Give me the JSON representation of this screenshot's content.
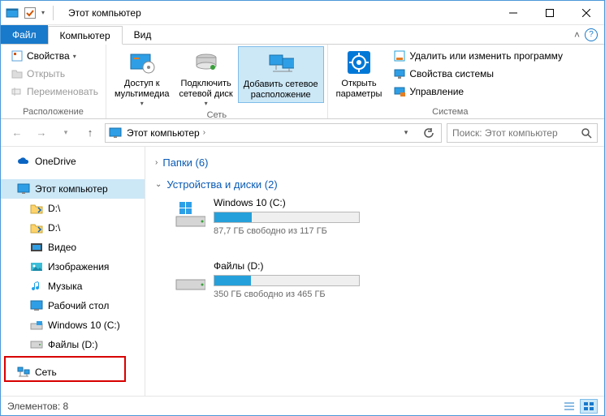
{
  "window": {
    "title": "Этот компьютер"
  },
  "tabs": {
    "file": "Файл",
    "computer": "Компьютер",
    "view": "Вид"
  },
  "ribbon": {
    "location": {
      "label": "Расположение",
      "properties": "Свойства",
      "open": "Открыть",
      "rename": "Переименовать"
    },
    "network": {
      "label": "Сеть",
      "media": "Доступ к\nмультимедиа",
      "mapdrive": "Подключить\nсетевой диск",
      "addloc": "Добавить сетевое\nрасположение"
    },
    "system": {
      "label": "Система",
      "opensettings": "Открыть\nпараметры",
      "uninstall": "Удалить или изменить программу",
      "sysprops": "Свойства системы",
      "manage": "Управление"
    }
  },
  "address": {
    "root": "Этот компьютер"
  },
  "search": {
    "placeholder": "Поиск: Этот компьютер"
  },
  "sidebar": {
    "onedrive": "OneDrive",
    "thispc": "Этот компьютер",
    "d1": "D:\\",
    "d2": "D:\\",
    "video": "Видео",
    "pictures": "Изображения",
    "music": "Музыка",
    "desktop": "Рабочий стол",
    "cdrive": "Windows 10 (C:)",
    "ddrive": "Файлы (D:)",
    "network": "Сеть"
  },
  "content": {
    "folders_header": "Папки (6)",
    "drives_header": "Устройства и диски (2)",
    "drives": [
      {
        "name": "Windows 10 (C:)",
        "free_text": "87,7 ГБ свободно из 117 ГБ",
        "fill_pct": 26
      },
      {
        "name": "Файлы (D:)",
        "free_text": "350 ГБ свободно из 465 ГБ",
        "fill_pct": 25
      }
    ]
  },
  "status": {
    "items": "Элементов: 8"
  }
}
